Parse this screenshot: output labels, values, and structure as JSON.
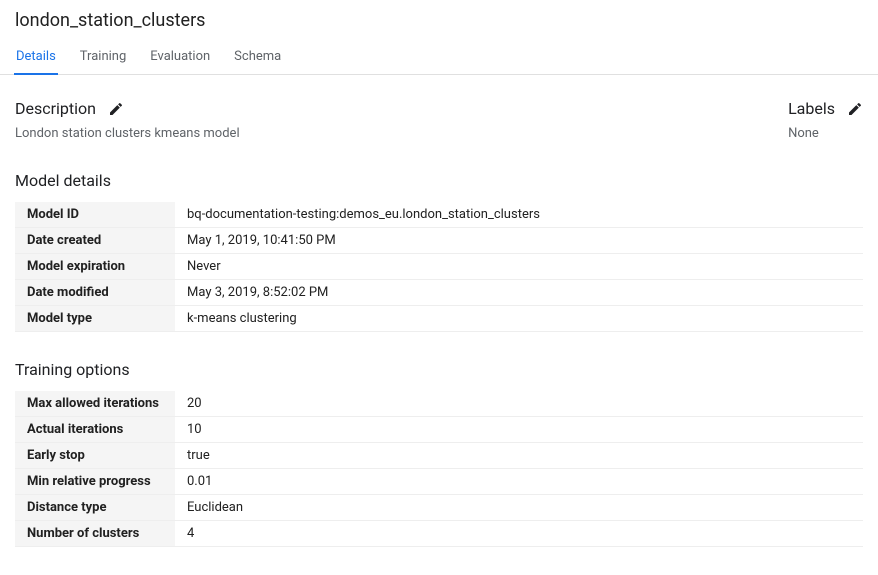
{
  "title": "london_station_clusters",
  "tabs": {
    "details": "Details",
    "training": "Training",
    "evaluation": "Evaluation",
    "schema": "Schema"
  },
  "description": {
    "heading": "Description",
    "value": "London station clusters kmeans model"
  },
  "labels": {
    "heading": "Labels",
    "value": "None"
  },
  "model_details": {
    "heading": "Model details",
    "rows": [
      {
        "key": "Model ID",
        "val": "bq-documentation-testing:demos_eu.london_station_clusters"
      },
      {
        "key": "Date created",
        "val": "May 1, 2019, 10:41:50 PM"
      },
      {
        "key": "Model expiration",
        "val": "Never"
      },
      {
        "key": "Date modified",
        "val": "May 3, 2019, 8:52:02 PM"
      },
      {
        "key": "Model type",
        "val": "k-means clustering"
      }
    ]
  },
  "training_options": {
    "heading": "Training options",
    "rows": [
      {
        "key": "Max allowed iterations",
        "val": "20"
      },
      {
        "key": "Actual iterations",
        "val": "10"
      },
      {
        "key": "Early stop",
        "val": "true"
      },
      {
        "key": "Min relative progress",
        "val": "0.01"
      },
      {
        "key": "Distance type",
        "val": "Euclidean"
      },
      {
        "key": "Number of clusters",
        "val": "4"
      }
    ]
  }
}
